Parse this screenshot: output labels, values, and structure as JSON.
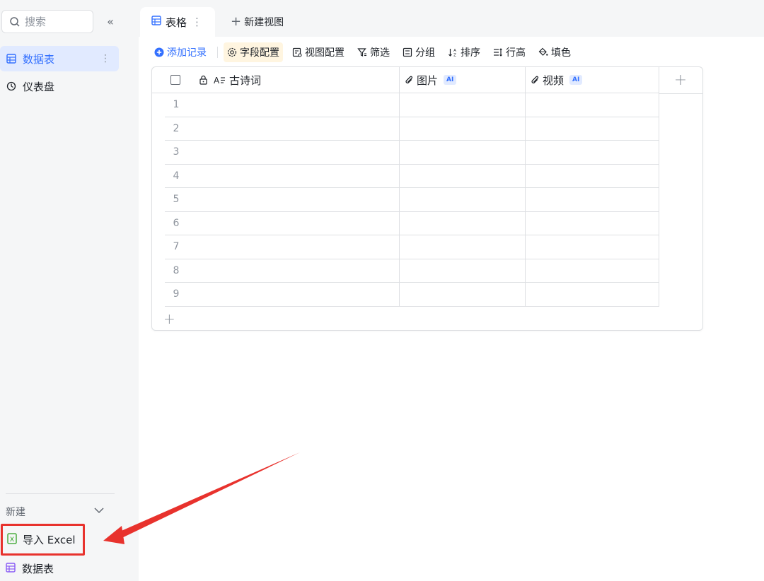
{
  "sidebar": {
    "search_placeholder": "搜索",
    "collapse_glyph": "«",
    "items": [
      {
        "label": "数据表",
        "icon": "table-icon",
        "active": true
      },
      {
        "label": "仪表盘",
        "icon": "dashboard-icon",
        "active": false
      }
    ],
    "more_glyph": "⋮",
    "new_label": "新建",
    "import_label": "导入 Excel",
    "bottom_item_label": "数据表"
  },
  "tabs": {
    "active_tab": "表格",
    "tab_more_glyph": "⋮",
    "new_view_label": "新建视图"
  },
  "toolbar": {
    "add_record": "添加记录",
    "field_config": "字段配置",
    "view_config": "视图配置",
    "filter": "筛选",
    "group": "分组",
    "sort": "排序",
    "row_height": "行高",
    "fill": "填色"
  },
  "grid": {
    "columns": [
      {
        "label": "古诗词",
        "icon": "text-field-icon",
        "locked": true,
        "ai": false
      },
      {
        "label": "图片",
        "icon": "attachment-icon",
        "ai": true
      },
      {
        "label": "视频",
        "icon": "attachment-icon",
        "ai": true
      }
    ],
    "ai_badge": "AI",
    "rows": [
      "1",
      "2",
      "3",
      "4",
      "5",
      "6",
      "7",
      "8",
      "9"
    ]
  },
  "colors": {
    "accent": "#3370ff",
    "highlight_border": "#e8322d",
    "arrow": "#e8322d"
  }
}
